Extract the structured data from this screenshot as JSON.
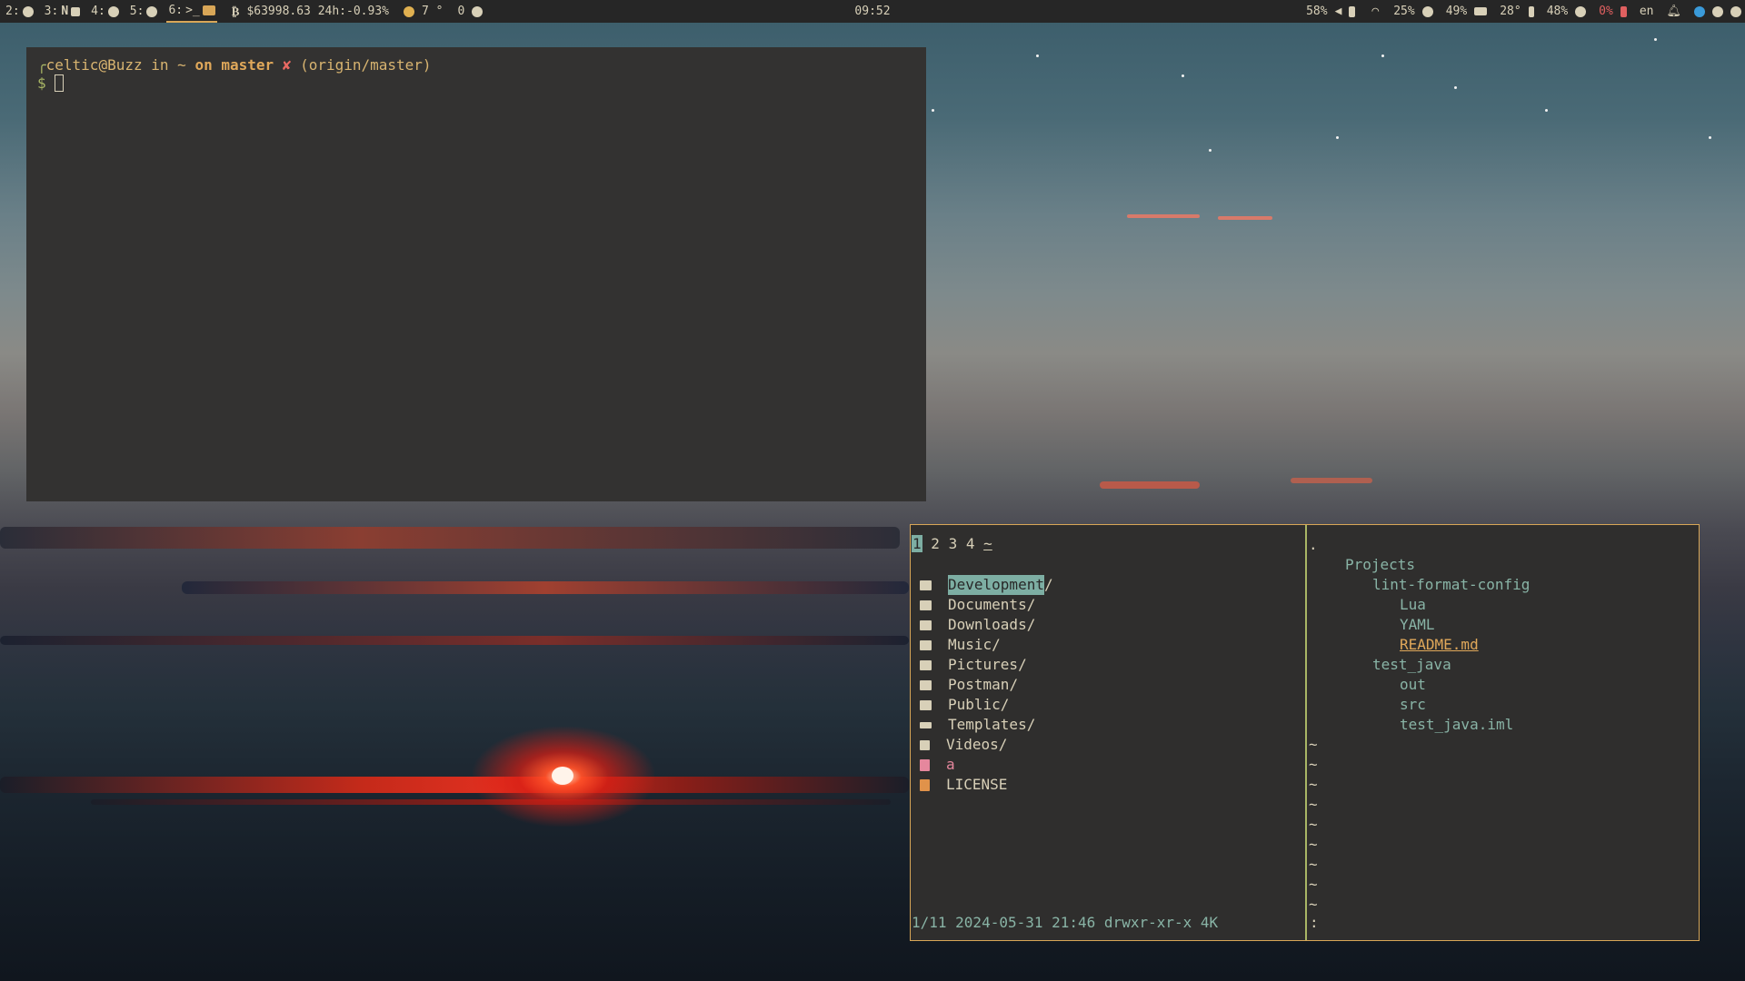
{
  "topbar": {
    "workspaces": [
      {
        "num": "2:",
        "icon": "power-icon"
      },
      {
        "num": "3:",
        "icon": "notion-icon",
        "extra": "N"
      },
      {
        "num": "4:",
        "icon": "telegram-icon"
      },
      {
        "num": "5:",
        "icon": "steam-icon"
      },
      {
        "num": "6:",
        "icon": "terminal-icon",
        "extra": ">_",
        "active": true
      }
    ],
    "bitcoin": "$63998.63 24h:-0.93%",
    "weather": "7 °",
    "updates": "0",
    "clock": "09:52",
    "volume": "58%",
    "cpu": "25%",
    "memory": "49%",
    "temperature": "28°",
    "brightness": "48%",
    "battery": "0%",
    "language": "en"
  },
  "terminal": {
    "user_host": "celtic@Buzz",
    "in": "in",
    "dir": "~",
    "on": "on",
    "branch": "master",
    "dirty_mark": "✘",
    "remote": "(origin/master)",
    "prompt_symbol": "$"
  },
  "file_manager": {
    "tabs": [
      "1",
      "2",
      "3",
      "4",
      "~"
    ],
    "entries": [
      {
        "name": "Development",
        "suffix": "/",
        "icon": "folder-icon",
        "selected": true
      },
      {
        "name": "Documents",
        "suffix": "/",
        "icon": "folder-documents-icon"
      },
      {
        "name": "Downloads",
        "suffix": "/",
        "icon": "folder-download-icon"
      },
      {
        "name": "Music",
        "suffix": "/",
        "icon": "folder-music-icon"
      },
      {
        "name": "Pictures",
        "suffix": "/",
        "icon": "folder-pictures-icon"
      },
      {
        "name": "Postman",
        "suffix": "/",
        "icon": "folder-icon"
      },
      {
        "name": "Public",
        "suffix": "/",
        "icon": "folder-icon"
      },
      {
        "name": "Templates",
        "suffix": "/",
        "icon": "templates-icon"
      },
      {
        "name": "Videos",
        "suffix": "/",
        "icon": "folder-videos-icon"
      },
      {
        "name": "a",
        "suffix": "",
        "icon": "file-icon",
        "kind": "file"
      },
      {
        "name": "LICENSE",
        "suffix": "",
        "icon": "license-icon",
        "kind": "license"
      }
    ],
    "preview": {
      "dot": ".",
      "tree": [
        {
          "text": "Projects",
          "depth": 1
        },
        {
          "text": "lint-format-config",
          "depth": 2
        },
        {
          "text": "Lua",
          "depth": 3
        },
        {
          "text": "YAML",
          "depth": 3
        },
        {
          "text": "README.md",
          "depth": 3,
          "highlight": true
        },
        {
          "text": "test_java",
          "depth": 2
        },
        {
          "text": "out",
          "depth": 3
        },
        {
          "text": "src",
          "depth": 3
        },
        {
          "text": "test_java.iml",
          "depth": 3
        }
      ],
      "tilde": "~",
      "tilde_count": 9
    },
    "status": "1/11 2024-05-31 21:46 drwxr-xr-x 4K",
    "command_line": ":"
  },
  "colors": {
    "accent": "#d8a657",
    "aqua": "#7daea3",
    "green": "#a9b665",
    "red": "#ea6962"
  }
}
